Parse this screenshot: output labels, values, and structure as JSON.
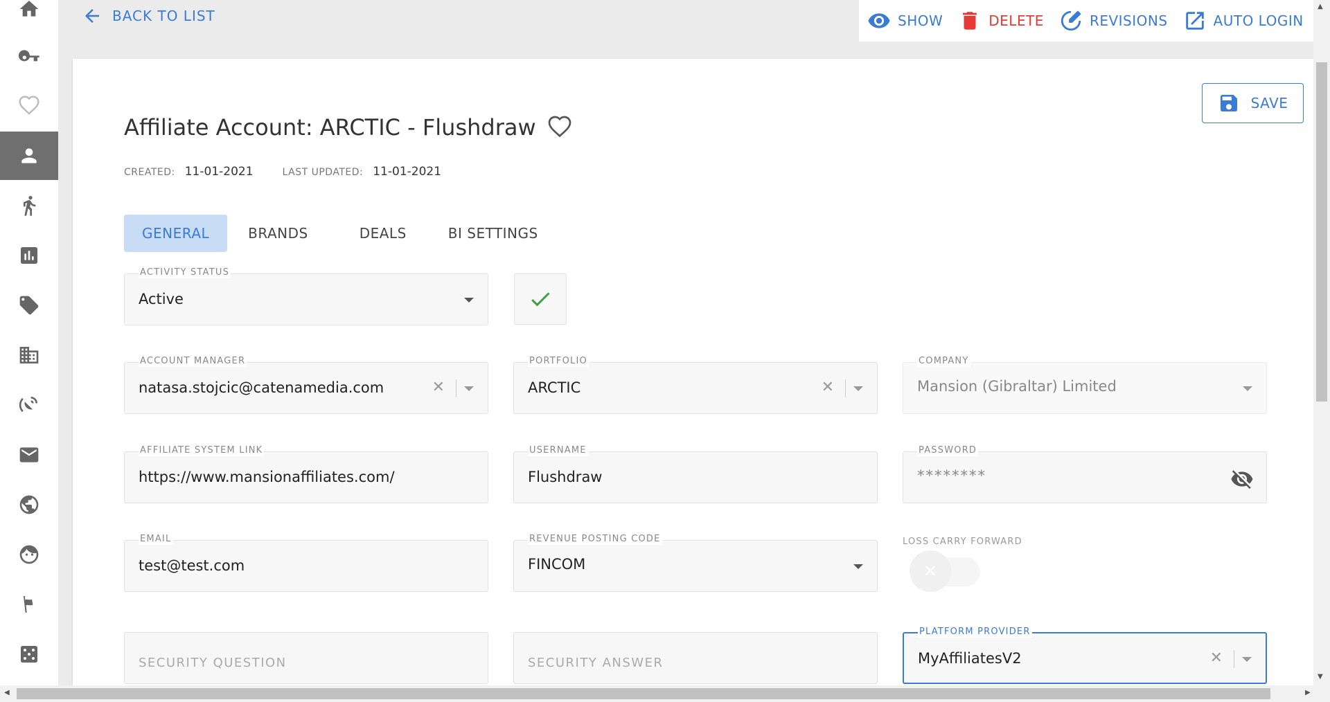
{
  "sidebar": {
    "items": [
      {
        "icon": "home-icon"
      },
      {
        "icon": "key-icon"
      },
      {
        "icon": "heart-outline-icon"
      },
      {
        "icon": "person-icon",
        "active": true
      },
      {
        "icon": "running-person-icon"
      },
      {
        "icon": "bar-chart-icon"
      },
      {
        "icon": "tag-icon"
      },
      {
        "icon": "building-icon"
      },
      {
        "icon": "satellite-dish-icon"
      },
      {
        "icon": "mail-icon"
      },
      {
        "icon": "globe-icon"
      },
      {
        "icon": "face-icon"
      },
      {
        "icon": "flag-icon"
      },
      {
        "icon": "dice-icon"
      }
    ]
  },
  "topbar": {
    "back_label": "BACK TO LIST",
    "actions": {
      "show": "SHOW",
      "delete": "DELETE",
      "revisions": "REVISIONS",
      "auto_login": "AUTO LOGIN"
    }
  },
  "card": {
    "save_label": "SAVE",
    "title": "Affiliate Account: ARCTIC - Flushdraw",
    "created_label": "CREATED:",
    "created_value": "11-01-2021",
    "updated_label": "LAST UPDATED:",
    "updated_value": "11-01-2021",
    "tabs": [
      {
        "label": "GENERAL",
        "active": true
      },
      {
        "label": "BRANDS"
      },
      {
        "label": "DEALS"
      },
      {
        "label": "BI SETTINGS"
      }
    ]
  },
  "form": {
    "activity_status": {
      "label": "ACTIVITY STATUS",
      "value": "Active"
    },
    "account_manager": {
      "label": "ACCOUNT MANAGER",
      "value": "natasa.stojcic@catenamedia.com"
    },
    "portfolio": {
      "label": "PORTFOLIO",
      "value": "ARCTIC"
    },
    "company": {
      "label": "COMPANY",
      "value": "Mansion (Gibraltar) Limited"
    },
    "affiliate_system_link": {
      "label": "AFFILIATE SYSTEM LINK",
      "value": "https://www.mansionaffiliates.com/"
    },
    "username": {
      "label": "USERNAME",
      "value": "Flushdraw"
    },
    "password": {
      "label": "PASSWORD",
      "value": "********"
    },
    "email": {
      "label": "EMAIL",
      "value": "test@test.com"
    },
    "revenue_posting_code": {
      "label": "REVENUE POSTING CODE",
      "value": "FINCOM"
    },
    "loss_carry_forward": {
      "label": "LOSS CARRY FORWARD",
      "checked": false
    },
    "security_question": {
      "placeholder": "SECURITY QUESTION"
    },
    "security_answer": {
      "placeholder": "SECURITY ANSWER"
    },
    "platform_provider": {
      "label": "PLATFORM PROVIDER",
      "value": "MyAffiliatesV2"
    }
  },
  "colors": {
    "accent": "#3a7bd5",
    "danger": "#e53935",
    "success": "#43a047",
    "sidebar_active": "#6f6f6f"
  }
}
